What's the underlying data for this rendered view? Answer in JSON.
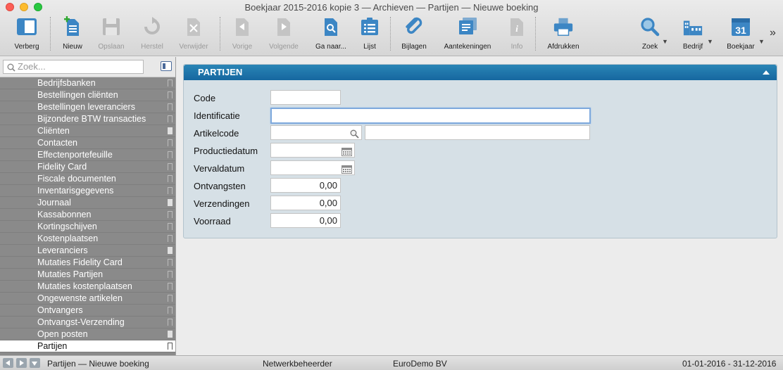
{
  "window": {
    "title": "Boekjaar 2015-2016 kopie 3 — Archieven — Partijen — Nieuwe boeking"
  },
  "toolbar": {
    "verberg": "Verberg",
    "nieuw": "Nieuw",
    "opslaan": "Opslaan",
    "herstel": "Herstel",
    "verwijder": "Verwijder",
    "vorige": "Vorige",
    "volgende": "Volgende",
    "ga_naar": "Ga naar...",
    "lijst": "Lijst",
    "bijlagen": "Bijlagen",
    "aantekeningen": "Aantekeningen",
    "info": "Info",
    "afdrukken": "Afdrukken",
    "zoek": "Zoek",
    "bedrijf": "Bedrijf",
    "boekjaar": "Boekjaar",
    "calendar_day": "31",
    "overflow": "»"
  },
  "sidebar": {
    "search_placeholder": "Zoek...",
    "items": [
      {
        "label": "Bedrijfsbanken",
        "bookmarked": false
      },
      {
        "label": "Bestellingen cliënten",
        "bookmarked": false
      },
      {
        "label": "Bestellingen leveranciers",
        "bookmarked": false
      },
      {
        "label": "Bijzondere BTW transacties",
        "bookmarked": false
      },
      {
        "label": "Cliënten",
        "bookmarked": true
      },
      {
        "label": "Contacten",
        "bookmarked": false
      },
      {
        "label": "Effectenportefeuille",
        "bookmarked": false
      },
      {
        "label": "Fidelity Card",
        "bookmarked": false
      },
      {
        "label": "Fiscale documenten",
        "bookmarked": false
      },
      {
        "label": "Inventarisgegevens",
        "bookmarked": false
      },
      {
        "label": "Journaal",
        "bookmarked": true
      },
      {
        "label": "Kassabonnen",
        "bookmarked": false
      },
      {
        "label": "Kortingschijven",
        "bookmarked": false
      },
      {
        "label": "Kostenplaatsen",
        "bookmarked": false
      },
      {
        "label": "Leveranciers",
        "bookmarked": true
      },
      {
        "label": "Mutaties Fidelity Card",
        "bookmarked": false
      },
      {
        "label": "Mutaties Partijen",
        "bookmarked": false
      },
      {
        "label": "Mutaties kostenplaatsen",
        "bookmarked": false
      },
      {
        "label": "Ongewenste artikelen",
        "bookmarked": false
      },
      {
        "label": "Ontvangers",
        "bookmarked": false
      },
      {
        "label": "Ontvangst-Verzending",
        "bookmarked": false
      },
      {
        "label": "Open posten",
        "bookmarked": true
      },
      {
        "label": "Partijen",
        "bookmarked": false,
        "selected": true
      }
    ]
  },
  "panel": {
    "title": "PARTIJEN",
    "fields": {
      "code": {
        "label": "Code",
        "value": ""
      },
      "identificatie": {
        "label": "Identificatie",
        "value": ""
      },
      "artikelcode": {
        "label": "Artikelcode",
        "value": "",
        "description": ""
      },
      "productiedatum": {
        "label": "Productiedatum",
        "value": ""
      },
      "vervaldatum": {
        "label": "Vervaldatum",
        "value": ""
      },
      "ontvangsten": {
        "label": "Ontvangsten",
        "value": "0,00"
      },
      "verzendingen": {
        "label": "Verzendingen",
        "value": "0,00"
      },
      "voorraad": {
        "label": "Voorraad",
        "value": "0,00"
      }
    }
  },
  "statusbar": {
    "record": "Partijen — Nieuwe boeking",
    "user": "Netwerkbeheerder",
    "company": "EuroDemo BV",
    "period": "01-01-2016 - 31-12-2016"
  },
  "colors": {
    "panel_header": "#1667a0",
    "panel_bg": "#d6e0e6",
    "sidebar_bg": "#8a8a8a"
  }
}
